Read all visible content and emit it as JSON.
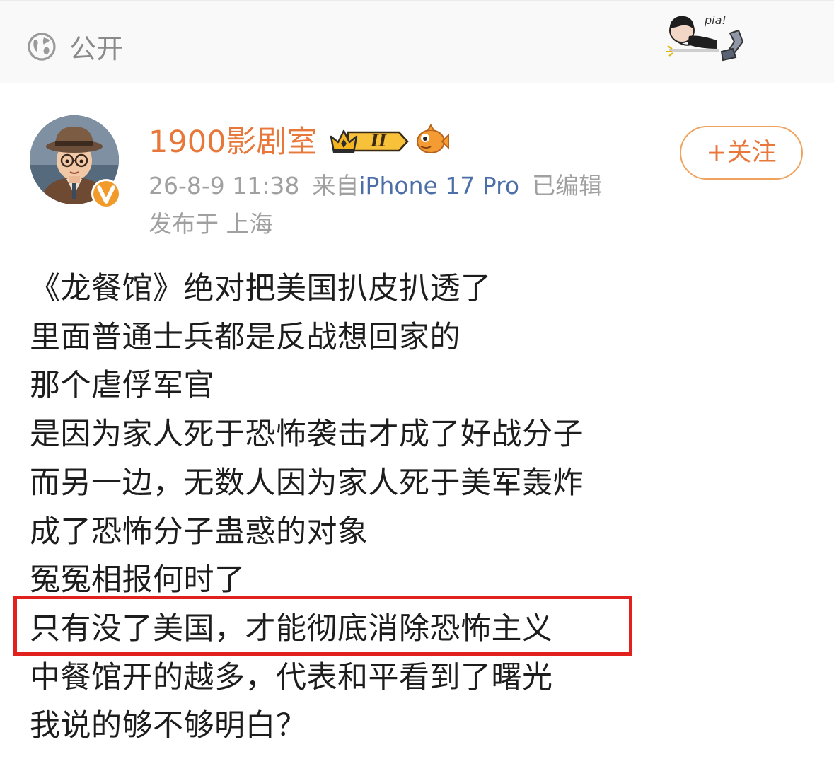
{
  "visibility": {
    "label": "公开",
    "icon": "globe-icon"
  },
  "sticker": {
    "text": "pia!"
  },
  "post": {
    "author": "1900影剧室",
    "rank_badge": "II",
    "time": "26-8-9 11:38",
    "source_prefix": "来自",
    "device": "iPhone 17 Pro",
    "edited": "已编辑",
    "location": "发布于 上海",
    "follow_label": "+关注",
    "lines": [
      "《龙餐馆》绝对把美国扒皮扒透了",
      "里面普通士兵都是反战想回家的",
      "那个虐俘军官",
      "是因为家人死于恐怖袭击才成了好战分子",
      "而另一边，无数人因为家人死于美军轰炸",
      "成了恐怖分子蛊惑的对象",
      "冤冤相报何时了",
      "只有没了美国，才能彻底消除恐怖主义",
      "中餐馆开的越多，代表和平看到了曙光",
      "我说的够不够明白？"
    ],
    "highlighted_line": 7
  },
  "colors": {
    "author": "#e8773a",
    "device_link": "#4d6fa8",
    "meta": "#a0a0a0",
    "highlight_border": "#e1211e",
    "follow_border": "#f0a35e"
  }
}
